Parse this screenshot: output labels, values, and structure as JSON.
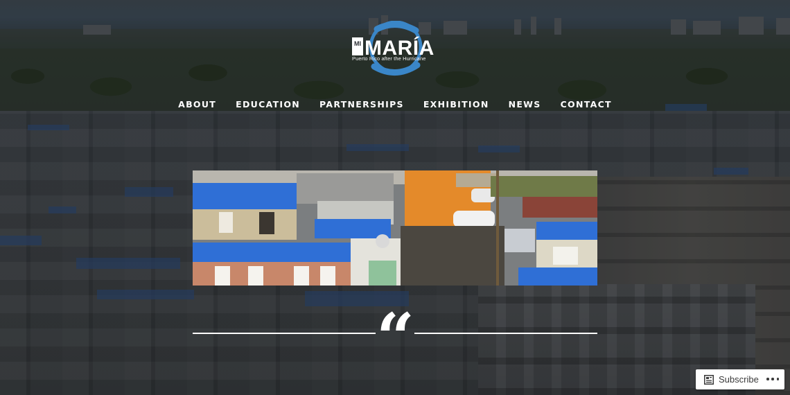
{
  "logo": {
    "wordmark_prefix": "MI",
    "wordmark": "MARÍA",
    "tagline": "Puerto Rico after the Hurricane",
    "accent_color": "#3a86c8"
  },
  "nav": {
    "items": [
      {
        "label": "ABOUT"
      },
      {
        "label": "EDUCATION"
      },
      {
        "label": "PARTNERSHIPS"
      },
      {
        "label": "EXHIBITION"
      },
      {
        "label": "NEWS"
      },
      {
        "label": "CONTACT"
      }
    ]
  },
  "featured_image": {
    "subject": "houses with blue tarp roofs"
  },
  "quote": {
    "mark": "“"
  },
  "subscribe_bar": {
    "label": "Subscribe",
    "icon": "subscribe-icon",
    "more_icon": "ellipsis-icon"
  },
  "colors": {
    "tarp_blue": "#2f6fd6",
    "nav_text": "#ffffff",
    "divider": "#ffffff"
  }
}
